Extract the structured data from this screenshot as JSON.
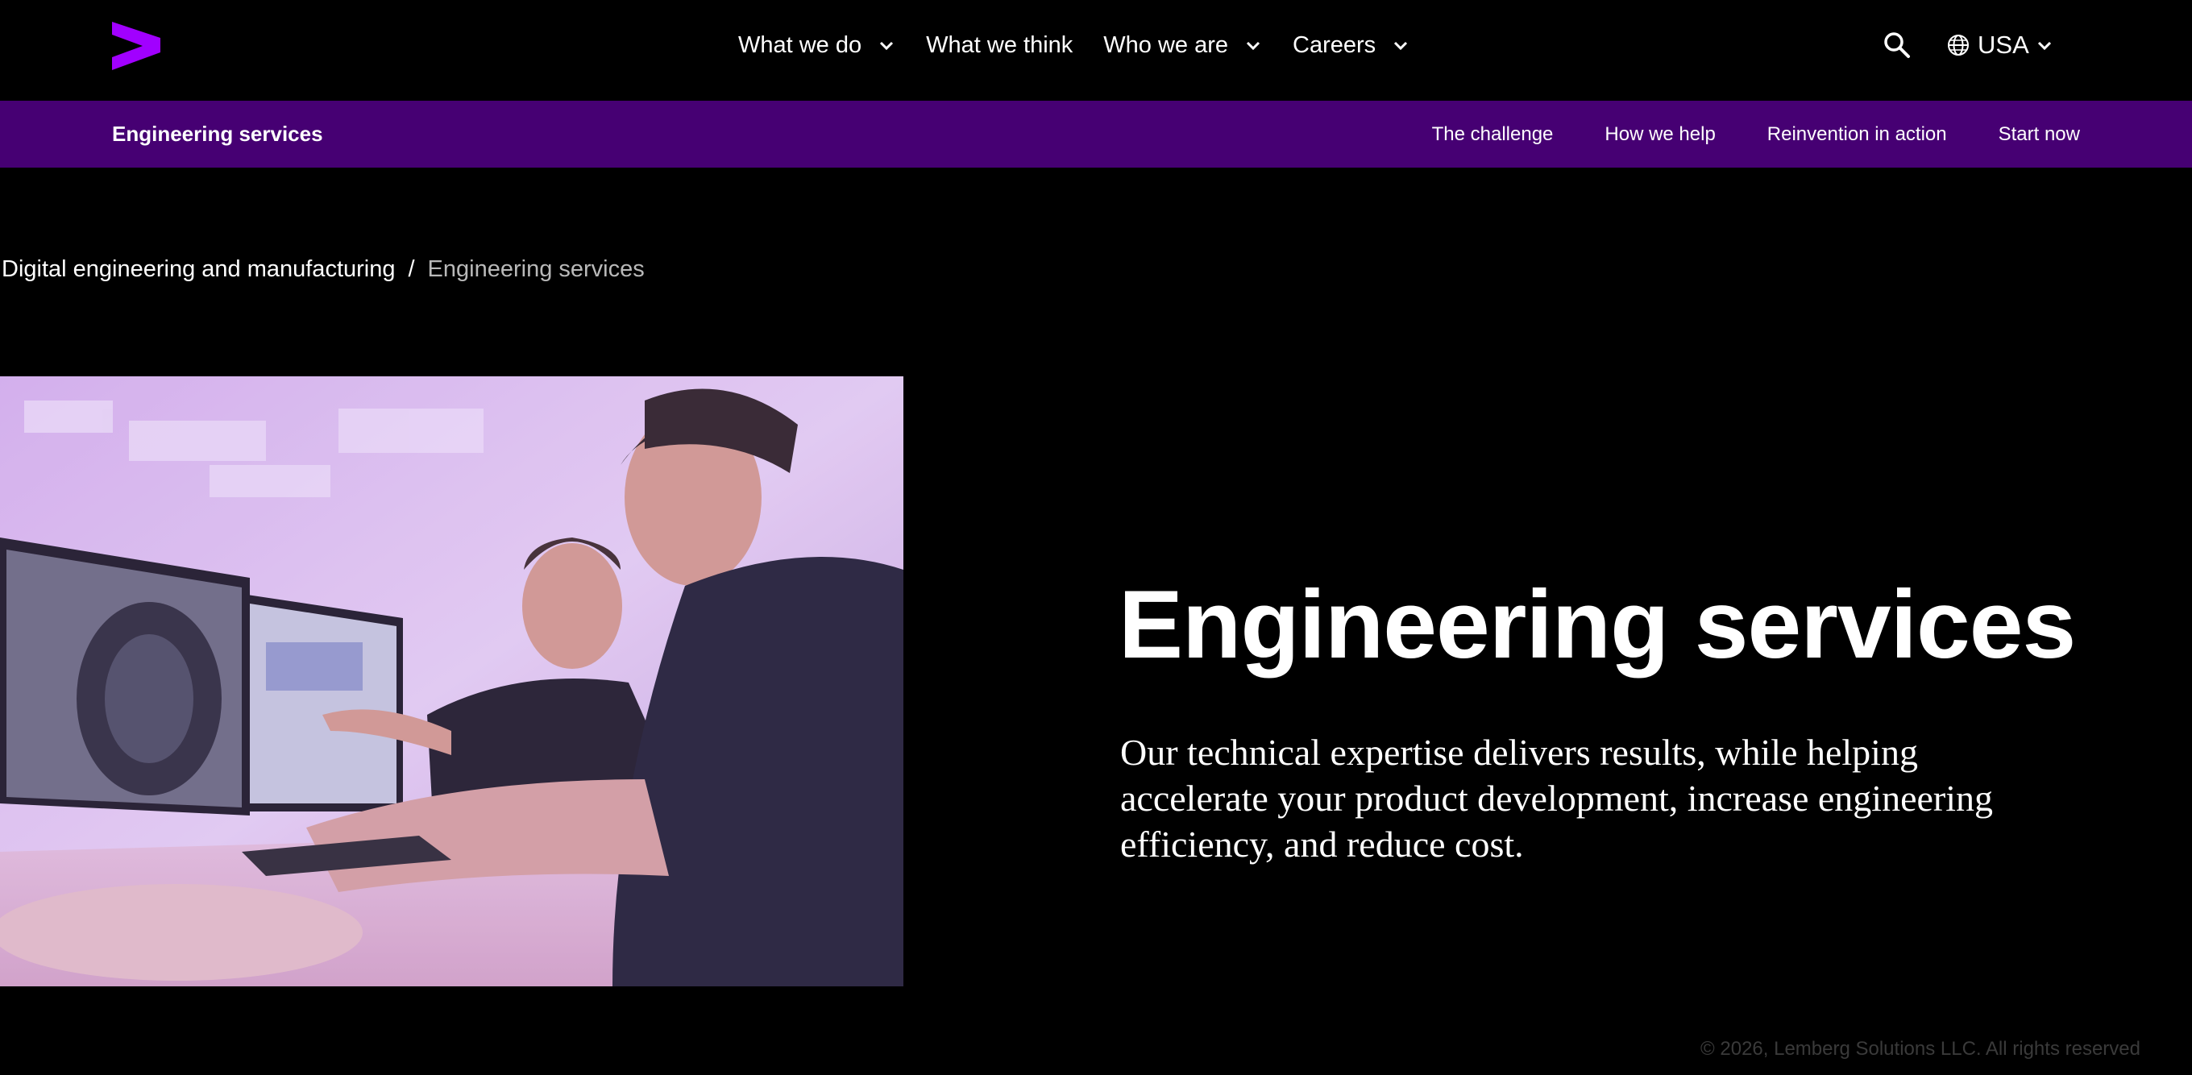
{
  "brand": {
    "logo_icon": "accenture-greater-than-logo",
    "accent": "#a100ff"
  },
  "topnav": {
    "items": [
      {
        "label": "What we do",
        "has_dropdown": true
      },
      {
        "label": "What we think",
        "has_dropdown": false
      },
      {
        "label": "Who we are",
        "has_dropdown": true
      },
      {
        "label": "Careers",
        "has_dropdown": true
      }
    ],
    "search_icon": "search-icon",
    "locale": {
      "label": "USA",
      "icon": "globe-icon"
    }
  },
  "subnav": {
    "title": "Engineering services",
    "links": [
      "The challenge",
      "How we help",
      "Reinvention in action",
      "Start now"
    ],
    "background": "#460073"
  },
  "breadcrumb": {
    "parent": "Digital engineering and manufacturing",
    "separator": "/",
    "current": "Engineering services"
  },
  "hero": {
    "title": "Engineering services",
    "description": "Our technical expertise delivers results, while helping accelerate your product development, increase engineering efficiency, and reduce cost."
  },
  "footer": {
    "copyright": "© 2026, Lemberg Solutions LLC. All rights reserved"
  }
}
